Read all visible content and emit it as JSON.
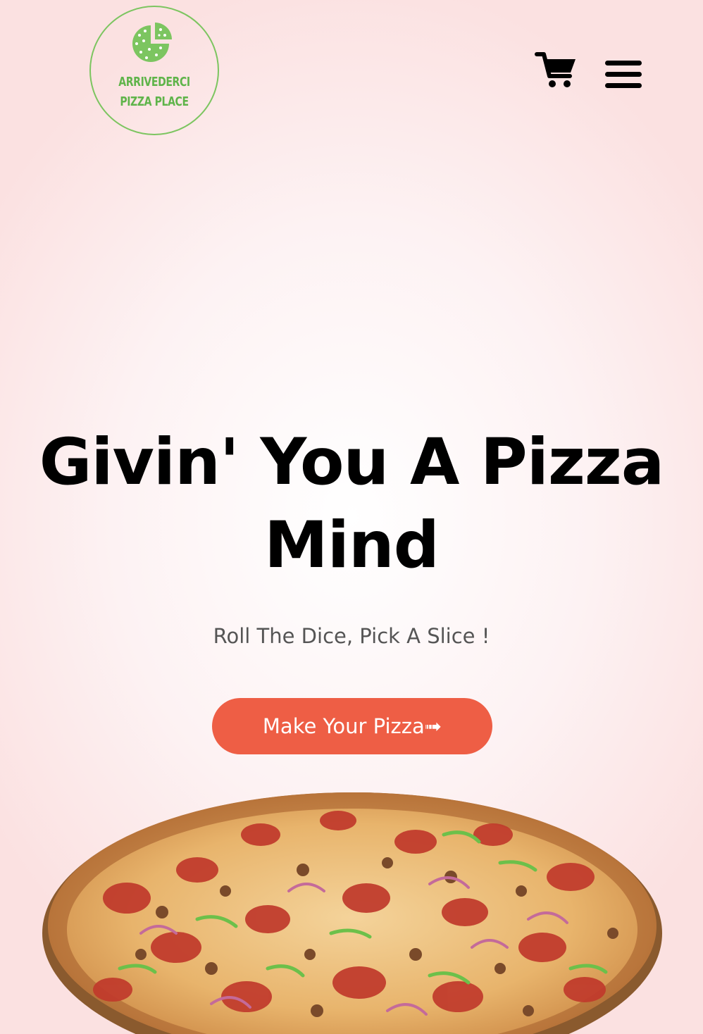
{
  "brand": {
    "line1": "ARRIVEDERCI",
    "line2": "PIZZA PLACE",
    "color": "#5fb44a"
  },
  "header": {
    "cart_icon": "shopping-cart-icon",
    "menu_icon": "hamburger-menu-icon"
  },
  "hero": {
    "headline": "Givin' You A Pizza Mind",
    "subtitle": "Roll The Dice, Pick A Slice !",
    "cta_label": "Make Your Pizza➟",
    "cta_color": "#ee5e45"
  }
}
